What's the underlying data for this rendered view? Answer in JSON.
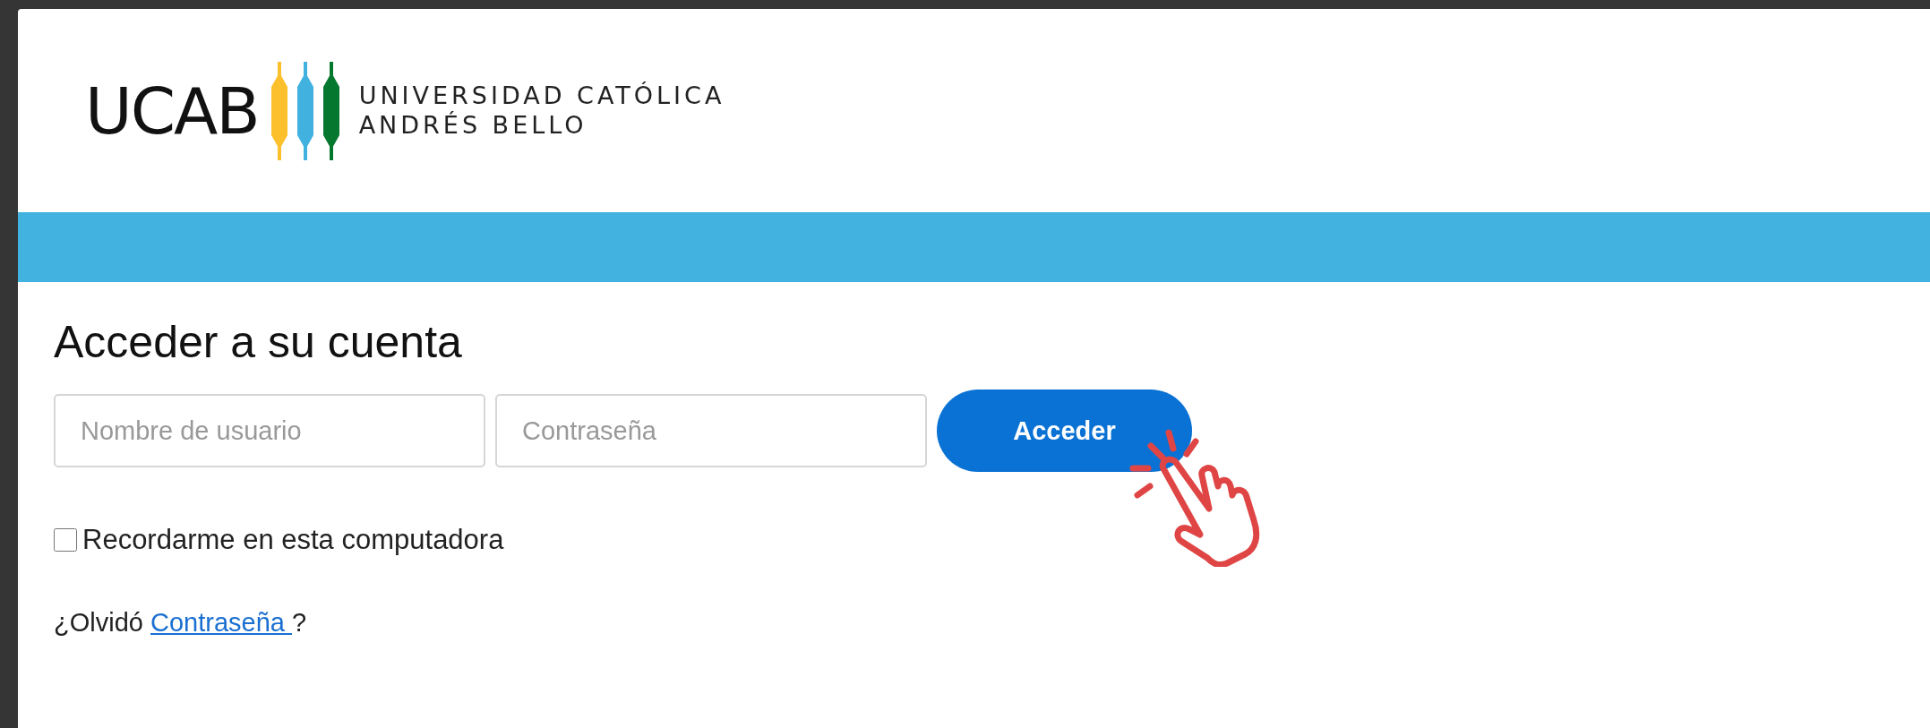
{
  "logo": {
    "wordmark": "UCAB",
    "name_lines": [
      "UNIVERSIDAD CATÓLICA",
      "ANDRÉS BELLO"
    ]
  },
  "login": {
    "heading": "Acceder a su cuenta",
    "username": {
      "placeholder": "Nombre de usuario"
    },
    "password": {
      "placeholder": "Contraseña"
    },
    "submit": "Acceder",
    "remember": {
      "label": "Recordarme en esta computadora",
      "checked": false
    },
    "forgot": {
      "prefix": "¿Olvidó ",
      "link": "Contraseña ",
      "suffix": "?"
    }
  }
}
